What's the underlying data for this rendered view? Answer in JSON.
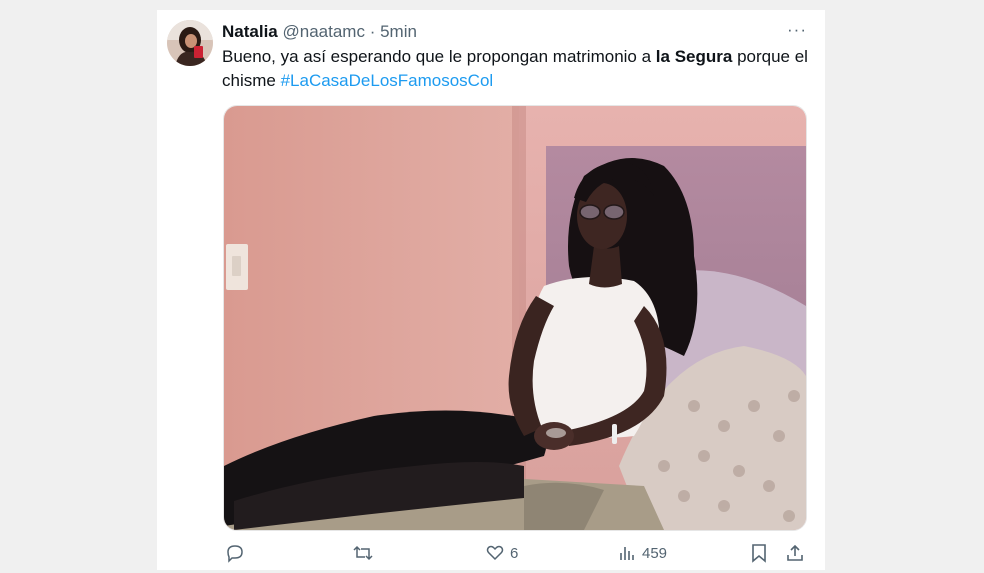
{
  "tweet": {
    "author_name": "Natalia",
    "handle": "@naatamc",
    "separator": "·",
    "time": "5min",
    "more_label": "···",
    "text_before": "Bueno, ya así esperando que le propongan matrimonio a ",
    "text_bold": "la Segura",
    "text_after": " porque el chisme ",
    "hashtag": "#LaCasaDeLosFamososCol"
  },
  "actions": {
    "reply_count": "",
    "retweet_count": "",
    "like_count": "6",
    "views_count": "459"
  },
  "colors": {
    "accent": "#1d9bf0",
    "text": "#0f1419",
    "muted": "#536471"
  },
  "icons": [
    "reply-icon",
    "retweet-icon",
    "heart-icon",
    "views-icon",
    "bookmark-icon",
    "share-icon",
    "more-icon"
  ]
}
